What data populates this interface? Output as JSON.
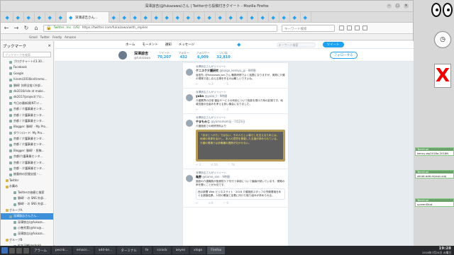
{
  "window": {
    "title": "深澤諒吉(@fukazawa)さん | Twitterから投稿付きクイート - Mozilla Firefox"
  },
  "browser": {
    "active_tab": "深澤諒吉さん...",
    "url_org": "Twitter, Inc. (US)",
    "url_path": "https://twitter.com/fukazawa/with_replies",
    "search_placeholder": "キーワード検索",
    "bookmarks_bar": [
      "Gmail",
      "Twitter",
      "Feedly",
      "Amazon"
    ]
  },
  "sidebar": {
    "title": "ブックマーク",
    "search_placeholder": "ブックマークを検索",
    "items": [
      {
        "label": "ブログチャート/(3.30...",
        "kind": "item"
      },
      {
        "label": "Facebook",
        "kind": "item"
      },
      {
        "label": "Google",
        "kind": "item"
      },
      {
        "label": "hiromi/2016knit/remo...",
        "kind": "item"
      },
      {
        "label": "勝崎! 技術全般 (外部...",
        "kind": "item"
      },
      {
        "label": "dk2016/ride at make...",
        "kind": "item"
      },
      {
        "label": "dk2017/project/プロ...",
        "kind": "item"
      },
      {
        "label": "今日の最新規(NT)イ...",
        "kind": "item"
      },
      {
        "label": "京都 / 介護事業センタ...",
        "kind": "item"
      },
      {
        "label": "京都 / 介護事業センタ...",
        "kind": "item"
      },
      {
        "label": "京都 / 介護事業センタ...",
        "kind": "item"
      },
      {
        "label": "Blogger: 勝崎! · My Pro...",
        "kind": "item"
      },
      {
        "label": "ダウンロード: My Pro...",
        "kind": "item"
      },
      {
        "label": "京都 / 介護事業センタ...",
        "kind": "item"
      },
      {
        "label": "京都 / 介護事業センタ...",
        "kind": "item"
      },
      {
        "label": "Blogger: 勝崎! · 投稿...",
        "kind": "item"
      },
      {
        "label": "京都/介護事業センタ...",
        "kind": "item"
      },
      {
        "label": "京都 / 介護事業センタ...",
        "kind": "item"
      },
      {
        "label": "京都・介護事業センタ...",
        "kind": "item"
      },
      {
        "label": "総督府の民間支援・...",
        "kind": "item"
      },
      {
        "label": "Twitter",
        "kind": "folder"
      },
      {
        "label": "お薦め",
        "kind": "folder"
      },
      {
        "label": "Twitterの価値と検索",
        "kind": "sub"
      },
      {
        "label": "勝崎! · の SNS 外部...",
        "kind": "sub"
      },
      {
        "label": "勝崎! · の SNS 外部...",
        "kind": "sub"
      },
      {
        "label": "グループA",
        "kind": "folder"
      },
      {
        "label": "深澤諒吉さんさん...",
        "kind": "sel"
      },
      {
        "label": "深澤諒吉(@fukaza...",
        "kind": "sub"
      },
      {
        "label": "小善秀実(@hiru@...",
        "kind": "sub"
      },
      {
        "label": "深澤諒吉(@fukaza...",
        "kind": "sub"
      },
      {
        "label": "グループB",
        "kind": "folder"
      },
      {
        "label": "松本正樹(@shokk...",
        "kind": "sub"
      },
      {
        "label": "黒谷洋平 Yuji Go...",
        "kind": "sub"
      }
    ]
  },
  "twitter": {
    "nav": {
      "home": "ホーム",
      "moments": "モーメント",
      "notifications": "通知",
      "messages": "メッセージ",
      "search_placeholder": "キーワード検索",
      "tweet": "ツイート"
    },
    "profile": {
      "name": "深澤諒吉",
      "handle": "@fukazawa",
      "follow": "フォローする"
    },
    "stats": [
      {
        "label": "ツイート",
        "value": "70,207"
      },
      {
        "label": "フォロー",
        "value": "432"
      },
      {
        "label": "フォロワー",
        "value": "6,009"
      },
      {
        "label": "いいね",
        "value": "32,810"
      }
    ],
    "tweets": [
      {
        "rt": "深澤諒吉さんがリツイート",
        "name": "ケニスケ介護研究",
        "handle": "@kaigo_kenkyu_jp · 8時間",
        "body": "返信先: @fukazawa_kai さん 職員研修でよく話題になりますが、実際に介護の現場で話し合える場を作るのは難しいですよね。",
        "acts": [
          "↩",
          "⟲ 2",
          "♡ 5"
        ]
      },
      {
        "rt": "深澤諒吉さんがリツイート",
        "name": "yuba",
        "handle": "@yuba_t · 9時間",
        "body": "介護業界の日常 福祉サービスの利用について相談を受けた時の記録です。地域支援の仕組みを考える良い機会になりました。",
        "acts": [
          "↩",
          "⟲ 1",
          "♡ 4"
        ]
      },
      {
        "rt": "深澤諒吉さんがリツイート",
        "name": "やまもみじ",
        "handle": "@yamamomiji · 7月23日",
        "body": "介護施設での研修資料より",
        "quote": "「あまじっかり」ではない、その人らしい暮らしを支えるためには、地域の資源を活かし、本人の意思を尊重した支援が求められている。介護の現場では多職種の連携が欠かせない。",
        "acts": [
          "↩ 3",
          "⟲ 56",
          "♡ 78"
        ]
      },
      {
        "rt": "深澤諒吉さんがリツイート",
        "name": "亀野",
        "handle": "@kame_sen · 9時間",
        "body": "施設の介護職員が医療的ケアを行う体制について議論が続いています。現場の声を聞くことが大切です。",
        "card": "西の新聞 Web ビジネスサイト · 2018 介護施設スタッフの労働環境をめぐる調査結果。人材の確保と定着に向けた取り組みが求められる。",
        "acts": [
          "↩",
          "⟲ 6",
          "♡ 9"
        ]
      }
    ]
  },
  "dock": {
    "terminals": [
      {
        "title": "Terminal",
        "text": "kenny-wp2018a-2018N"
      },
      {
        "title": "Terminal",
        "text": "zenet-add-mysql-ucaj"
      },
      {
        "title": "Terminal",
        "text": "screenShot"
      }
    ]
  },
  "taskbar": {
    "items": [
      "アラーム",
      "pecnk...",
      "emacs...",
      "add-ke...",
      "ターミナル",
      "fe",
      "scrock",
      "aeyes",
      "xlogo",
      "Firefox"
    ],
    "time": "19:28",
    "date": "2018年7月24日 火曜日"
  }
}
